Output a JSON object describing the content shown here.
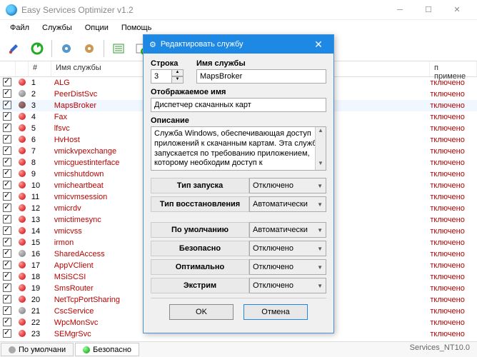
{
  "window": {
    "title": "Easy Services Optimizer v1.2",
    "min_icon": "minimize-icon",
    "max_icon": "maximize-icon",
    "close_icon": "close-icon"
  },
  "menu": [
    "Файл",
    "Службы",
    "Опции",
    "Помощь"
  ],
  "columns": {
    "num": "#",
    "name": "Имя службы",
    "status_prefix": "п примене"
  },
  "rows": [
    {
      "n": "1",
      "svc": "ALG",
      "bullet": "red",
      "st": "тключено"
    },
    {
      "n": "2",
      "svc": "PeerDistSvc",
      "bullet": "grey",
      "st": "тключено"
    },
    {
      "n": "3",
      "svc": "MapsBroker",
      "bullet": "dark",
      "st": "тключено",
      "sel": true
    },
    {
      "n": "4",
      "svc": "Fax",
      "bullet": "red",
      "st": "тключено"
    },
    {
      "n": "5",
      "svc": "lfsvc",
      "bullet": "red",
      "st": "тключено"
    },
    {
      "n": "6",
      "svc": "HvHost",
      "bullet": "red",
      "st": "тключено"
    },
    {
      "n": "7",
      "svc": "vmickvpexchange",
      "bullet": "red",
      "st": "тключено"
    },
    {
      "n": "8",
      "svc": "vmicguestinterface",
      "bullet": "red",
      "st": "тключено"
    },
    {
      "n": "9",
      "svc": "vmicshutdown",
      "bullet": "red",
      "st": "тключено"
    },
    {
      "n": "10",
      "svc": "vmicheartbeat",
      "bullet": "red",
      "st": "тключено"
    },
    {
      "n": "11",
      "svc": "vmicvmsession",
      "bullet": "red",
      "st": "тключено"
    },
    {
      "n": "12",
      "svc": "vmicrdv",
      "bullet": "red",
      "st": "тключено"
    },
    {
      "n": "13",
      "svc": "vmictimesync",
      "bullet": "red",
      "st": "тключено"
    },
    {
      "n": "14",
      "svc": "vmicvss",
      "bullet": "red",
      "st": "тключено"
    },
    {
      "n": "15",
      "svc": "irmon",
      "bullet": "red",
      "st": "тключено"
    },
    {
      "n": "16",
      "svc": "SharedAccess",
      "bullet": "grey",
      "st": "тключено"
    },
    {
      "n": "17",
      "svc": "AppVClient",
      "bullet": "red",
      "st": "тключено"
    },
    {
      "n": "18",
      "svc": "MSiSCSI",
      "bullet": "red",
      "st": "тключено"
    },
    {
      "n": "19",
      "svc": "SmsRouter",
      "bullet": "red",
      "st": "тключено"
    },
    {
      "n": "20",
      "svc": "NetTcpPortSharing",
      "bullet": "red",
      "st": "тключено"
    },
    {
      "n": "21",
      "svc": "CscService",
      "bullet": "grey",
      "st": "тключено"
    },
    {
      "n": "22",
      "svc": "WpcMonSvc",
      "bullet": "red",
      "st": "тключено"
    },
    {
      "n": "23",
      "svc": "SEMgrSvc",
      "bullet": "red",
      "st": "тключено"
    }
  ],
  "dialog": {
    "title": "Редактировать службу",
    "line_label": "Строка",
    "line_value": "3",
    "name_label": "Имя службы",
    "name_value": "MapsBroker",
    "display_label": "Отображаемое имя",
    "display_value": "Диспетчер скачанных карт",
    "desc_label": "Описание",
    "desc_value": "Служба Windows, обеспечивающая доступ приложений к скачанным картам. Эта служба запускается по требованию приложением, которому необходим доступ к",
    "opts": [
      {
        "label": "Тип запуска",
        "value": "Отключено"
      },
      {
        "label": "Тип восстановления",
        "value": "Автоматически"
      }
    ],
    "profiles": [
      {
        "label": "По умолчанию",
        "value": "Автоматически"
      },
      {
        "label": "Безопасно",
        "value": "Отключено"
      },
      {
        "label": "Оптимально",
        "value": "Отключено"
      },
      {
        "label": "Экстрим",
        "value": "Отключено"
      }
    ],
    "ok": "OK",
    "cancel": "Отмена"
  },
  "statusbar": {
    "tab1": "По умолчани",
    "tab2": "Безопасно",
    "file": "Services_NT10.0"
  }
}
